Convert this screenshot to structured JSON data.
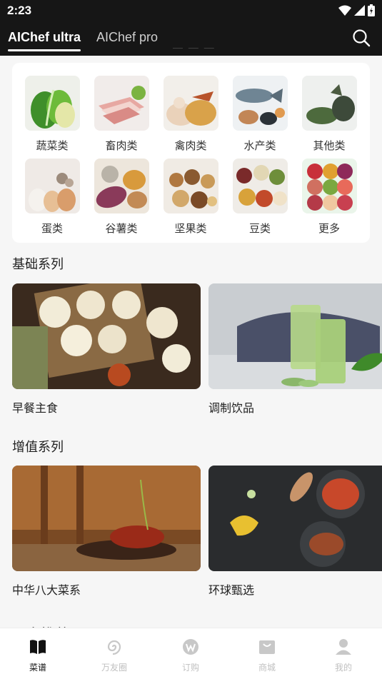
{
  "status": {
    "time": "2:23"
  },
  "header": {
    "tabs": [
      {
        "label": "AIChef ultra",
        "active": true
      },
      {
        "label": "AIChef pro",
        "active": false
      }
    ]
  },
  "categories": [
    {
      "label": "蔬菜类",
      "icon": "vegetables"
    },
    {
      "label": "畜肉类",
      "icon": "red-meat"
    },
    {
      "label": "禽肉类",
      "icon": "poultry"
    },
    {
      "label": "水产类",
      "icon": "seafood"
    },
    {
      "label": "其他类",
      "icon": "others"
    },
    {
      "label": "蛋类",
      "icon": "eggs"
    },
    {
      "label": "谷薯类",
      "icon": "grains"
    },
    {
      "label": "坚果类",
      "icon": "nuts"
    },
    {
      "label": "豆类",
      "icon": "beans"
    },
    {
      "label": "更多",
      "icon": "more"
    }
  ],
  "sections": [
    {
      "title": "基础系列",
      "items": [
        {
          "label": "早餐主食"
        },
        {
          "label": "调制饮品"
        }
      ]
    },
    {
      "title": "增值系列",
      "items": [
        {
          "label": "中华八大菜系"
        },
        {
          "label": "环球甄选"
        }
      ]
    }
  ],
  "next_section_peek": "更多推荐",
  "bottom_nav": [
    {
      "label": "菜谱",
      "icon": "book-icon",
      "active": true
    },
    {
      "label": "万友圈",
      "icon": "spiral-icon",
      "active": false
    },
    {
      "label": "订购",
      "icon": "w-logo-icon",
      "active": false
    },
    {
      "label": "商城",
      "icon": "bag-icon",
      "active": false
    },
    {
      "label": "我的",
      "icon": "person-icon",
      "active": false
    }
  ],
  "colors": {
    "header_bg": "#161616",
    "page_bg": "#f6f6f6",
    "active": "#111111",
    "inactive": "#c0c0c0"
  }
}
